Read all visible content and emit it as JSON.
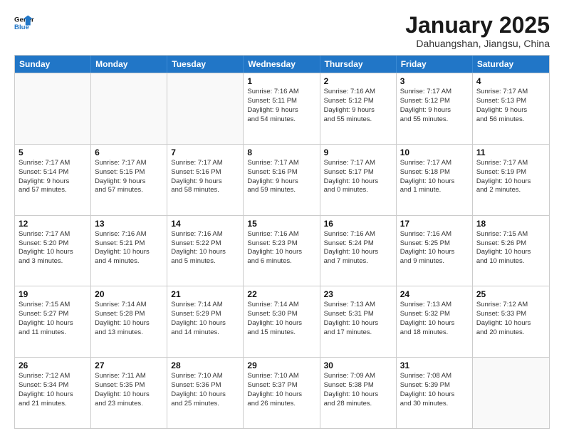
{
  "header": {
    "logo_line1": "General",
    "logo_line2": "Blue",
    "month_title": "January 2025",
    "location": "Dahuangshan, Jiangsu, China"
  },
  "days_of_week": [
    "Sunday",
    "Monday",
    "Tuesday",
    "Wednesday",
    "Thursday",
    "Friday",
    "Saturday"
  ],
  "weeks": [
    [
      {
        "day": "",
        "info": ""
      },
      {
        "day": "",
        "info": ""
      },
      {
        "day": "",
        "info": ""
      },
      {
        "day": "1",
        "info": "Sunrise: 7:16 AM\nSunset: 5:11 PM\nDaylight: 9 hours\nand 54 minutes."
      },
      {
        "day": "2",
        "info": "Sunrise: 7:16 AM\nSunset: 5:12 PM\nDaylight: 9 hours\nand 55 minutes."
      },
      {
        "day": "3",
        "info": "Sunrise: 7:17 AM\nSunset: 5:12 PM\nDaylight: 9 hours\nand 55 minutes."
      },
      {
        "day": "4",
        "info": "Sunrise: 7:17 AM\nSunset: 5:13 PM\nDaylight: 9 hours\nand 56 minutes."
      }
    ],
    [
      {
        "day": "5",
        "info": "Sunrise: 7:17 AM\nSunset: 5:14 PM\nDaylight: 9 hours\nand 57 minutes."
      },
      {
        "day": "6",
        "info": "Sunrise: 7:17 AM\nSunset: 5:15 PM\nDaylight: 9 hours\nand 57 minutes."
      },
      {
        "day": "7",
        "info": "Sunrise: 7:17 AM\nSunset: 5:16 PM\nDaylight: 9 hours\nand 58 minutes."
      },
      {
        "day": "8",
        "info": "Sunrise: 7:17 AM\nSunset: 5:16 PM\nDaylight: 9 hours\nand 59 minutes."
      },
      {
        "day": "9",
        "info": "Sunrise: 7:17 AM\nSunset: 5:17 PM\nDaylight: 10 hours\nand 0 minutes."
      },
      {
        "day": "10",
        "info": "Sunrise: 7:17 AM\nSunset: 5:18 PM\nDaylight: 10 hours\nand 1 minute."
      },
      {
        "day": "11",
        "info": "Sunrise: 7:17 AM\nSunset: 5:19 PM\nDaylight: 10 hours\nand 2 minutes."
      }
    ],
    [
      {
        "day": "12",
        "info": "Sunrise: 7:17 AM\nSunset: 5:20 PM\nDaylight: 10 hours\nand 3 minutes."
      },
      {
        "day": "13",
        "info": "Sunrise: 7:16 AM\nSunset: 5:21 PM\nDaylight: 10 hours\nand 4 minutes."
      },
      {
        "day": "14",
        "info": "Sunrise: 7:16 AM\nSunset: 5:22 PM\nDaylight: 10 hours\nand 5 minutes."
      },
      {
        "day": "15",
        "info": "Sunrise: 7:16 AM\nSunset: 5:23 PM\nDaylight: 10 hours\nand 6 minutes."
      },
      {
        "day": "16",
        "info": "Sunrise: 7:16 AM\nSunset: 5:24 PM\nDaylight: 10 hours\nand 7 minutes."
      },
      {
        "day": "17",
        "info": "Sunrise: 7:16 AM\nSunset: 5:25 PM\nDaylight: 10 hours\nand 9 minutes."
      },
      {
        "day": "18",
        "info": "Sunrise: 7:15 AM\nSunset: 5:26 PM\nDaylight: 10 hours\nand 10 minutes."
      }
    ],
    [
      {
        "day": "19",
        "info": "Sunrise: 7:15 AM\nSunset: 5:27 PM\nDaylight: 10 hours\nand 11 minutes."
      },
      {
        "day": "20",
        "info": "Sunrise: 7:14 AM\nSunset: 5:28 PM\nDaylight: 10 hours\nand 13 minutes."
      },
      {
        "day": "21",
        "info": "Sunrise: 7:14 AM\nSunset: 5:29 PM\nDaylight: 10 hours\nand 14 minutes."
      },
      {
        "day": "22",
        "info": "Sunrise: 7:14 AM\nSunset: 5:30 PM\nDaylight: 10 hours\nand 15 minutes."
      },
      {
        "day": "23",
        "info": "Sunrise: 7:13 AM\nSunset: 5:31 PM\nDaylight: 10 hours\nand 17 minutes."
      },
      {
        "day": "24",
        "info": "Sunrise: 7:13 AM\nSunset: 5:32 PM\nDaylight: 10 hours\nand 18 minutes."
      },
      {
        "day": "25",
        "info": "Sunrise: 7:12 AM\nSunset: 5:33 PM\nDaylight: 10 hours\nand 20 minutes."
      }
    ],
    [
      {
        "day": "26",
        "info": "Sunrise: 7:12 AM\nSunset: 5:34 PM\nDaylight: 10 hours\nand 21 minutes."
      },
      {
        "day": "27",
        "info": "Sunrise: 7:11 AM\nSunset: 5:35 PM\nDaylight: 10 hours\nand 23 minutes."
      },
      {
        "day": "28",
        "info": "Sunrise: 7:10 AM\nSunset: 5:36 PM\nDaylight: 10 hours\nand 25 minutes."
      },
      {
        "day": "29",
        "info": "Sunrise: 7:10 AM\nSunset: 5:37 PM\nDaylight: 10 hours\nand 26 minutes."
      },
      {
        "day": "30",
        "info": "Sunrise: 7:09 AM\nSunset: 5:38 PM\nDaylight: 10 hours\nand 28 minutes."
      },
      {
        "day": "31",
        "info": "Sunrise: 7:08 AM\nSunset: 5:39 PM\nDaylight: 10 hours\nand 30 minutes."
      },
      {
        "day": "",
        "info": ""
      }
    ]
  ]
}
